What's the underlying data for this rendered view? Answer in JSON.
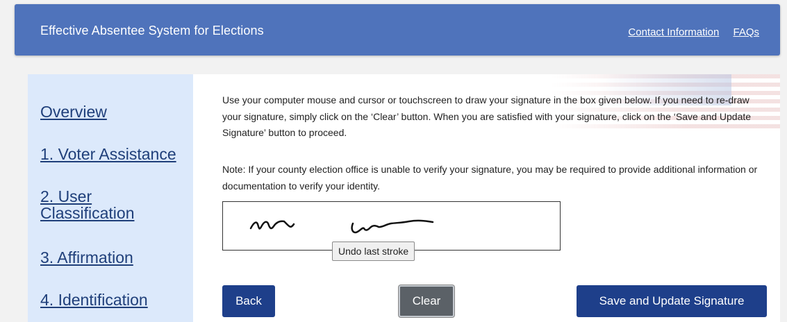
{
  "header": {
    "title": "Effective Absentee System for Elections",
    "links": [
      "Contact Information",
      "FAQs"
    ]
  },
  "sidebar": {
    "items": [
      {
        "label": "Overview"
      },
      {
        "label": "1. Voter Assistance"
      },
      {
        "label": "2. User Classification"
      },
      {
        "label": "3. Affirmation"
      },
      {
        "label": "4. Identification"
      }
    ]
  },
  "main": {
    "instructions": "Use your computer mouse and cursor or touchscreen to draw your signature in the box given below. If you need to re-draw your signature, simply click on the ‘Clear’ button. When you are satisfied with your signature, click on the ‘Save and Update Signature’ button to proceed.",
    "note": "Note: If your county election office is unable to verify your signature, you may be required to provide additional information or documentation to verify your identity.",
    "undo_label": "Undo last stroke",
    "buttons": {
      "back": "Back",
      "clear": "Clear",
      "save": "Save and Update Signature"
    }
  },
  "colors": {
    "header_bg": "#4f73bb",
    "sidebar_bg": "#dce9fb",
    "primary_button": "#1e3f8a",
    "clear_button": "#5b6167"
  }
}
